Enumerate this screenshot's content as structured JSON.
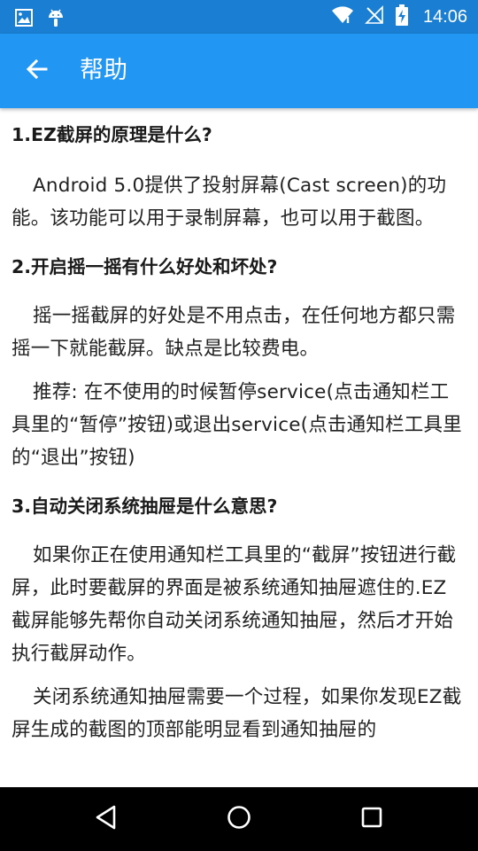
{
  "status_bar": {
    "time": "14:06",
    "icons": [
      "image-icon",
      "android-icon",
      "wifi-icon",
      "no-signal-icon",
      "battery-charging-icon"
    ]
  },
  "app_bar": {
    "title": "帮助",
    "back_icon": "arrow-left-icon"
  },
  "help": {
    "sections": [
      {
        "question": "1.EZ截屏的原理是什么?",
        "paragraphs": [
          "Android 5.0提供了投射屏幕(Cast screen)的功能。该功能可以用于录制屏幕，也可以用于截图。"
        ]
      },
      {
        "question": "2.开启摇一摇有什么好处和坏处?",
        "paragraphs": [
          "摇一摇截屏的好处是不用点击，在任何地方都只需摇一下就能截屏。缺点是比较费电。",
          "推荐: 在不使用的时候暂停service(点击通知栏工具里的“暂停”按钮)或退出service(点击通知栏工具里的“退出”按钮)"
        ]
      },
      {
        "question": "3.自动关闭系统抽屉是什么意思?",
        "paragraphs": [
          "如果你正在使用通知栏工具里的“截屏”按钮进行截屏，此时要截屏的界面是被系统通知抽屉遮住的.EZ截屏能够先帮你自动关闭系统通知抽屉，然后才开始执行截屏动作。",
          "关闭系统通知抽屉需要一个过程，如果你发现EZ截屏生成的截图的顶部能明显看到通知抽屉的"
        ]
      }
    ]
  },
  "nav_bar": {
    "icons": [
      "back-triangle-icon",
      "home-circle-icon",
      "recents-square-icon"
    ]
  },
  "colors": {
    "status_bar": "#1a7fd2",
    "app_bar": "#2196f3",
    "nav_bar": "#000000",
    "text": "#212121"
  }
}
